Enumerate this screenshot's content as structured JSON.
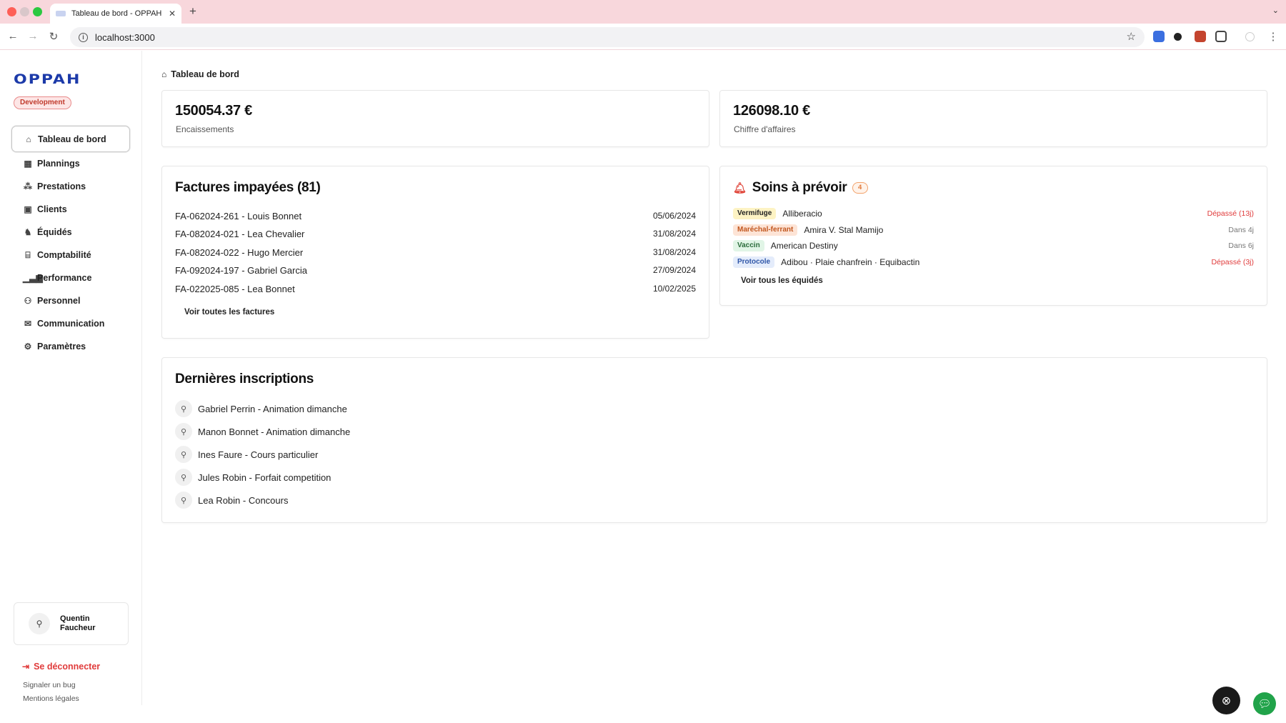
{
  "browser": {
    "tab_title": "Tableau de bord - OPPAH",
    "url": "localhost:3000"
  },
  "app": {
    "logo_text": "OPPAH",
    "environment": "Development"
  },
  "sidebar": {
    "items": [
      {
        "label": "Tableau de bord",
        "icon": "home-icon",
        "active": true
      },
      {
        "label": "Plannings",
        "icon": "calendar-icon"
      },
      {
        "label": "Prestations",
        "icon": "boxes-icon"
      },
      {
        "label": "Clients",
        "icon": "contact-icon"
      },
      {
        "label": "Équidés",
        "icon": "horse-icon"
      },
      {
        "label": "Comptabilité",
        "icon": "bank-icon"
      },
      {
        "label": "Performance",
        "icon": "bar-chart-icon"
      },
      {
        "label": "Personnel",
        "icon": "users-icon"
      },
      {
        "label": "Communication",
        "icon": "mail-icon"
      },
      {
        "label": "Paramètres",
        "icon": "gear-icon"
      }
    ],
    "user_name": "Quentin Faucheur",
    "logout_label": "Se déconnecter",
    "report_bug_label": "Signaler un bug",
    "legal_label": "Mentions légales"
  },
  "breadcrumb": {
    "label": "Tableau de bord"
  },
  "stats": {
    "collections": {
      "value": "150054.37 €",
      "label": "Encaissements"
    },
    "revenue": {
      "value": "126098.10 €",
      "label": "Chiffre d'affaires"
    }
  },
  "unpaid_invoices": {
    "title": "Factures impayées (81)",
    "rows": [
      {
        "label": "FA-062024-261 - Louis Bonnet",
        "date": "05/06/2024"
      },
      {
        "label": "FA-082024-021 - Lea Chevalier",
        "date": "31/08/2024"
      },
      {
        "label": "FA-082024-022 - Hugo Mercier",
        "date": "31/08/2024"
      },
      {
        "label": "FA-092024-197 - Gabriel Garcia",
        "date": "27/09/2024"
      },
      {
        "label": "FA-022025-085 - Lea Bonnet",
        "date": "10/02/2025"
      }
    ],
    "view_all_label": "Voir toutes les factures"
  },
  "care": {
    "title": "Soins à prévoir",
    "count": "4",
    "rows": [
      {
        "tag": "Vermifuge",
        "tag_bg": "#fdf3c4",
        "tag_color": "#222222",
        "name": "Alliberacio",
        "due": "Dépassé (13j)",
        "late": true
      },
      {
        "tag": "Maréchal-ferrant",
        "tag_bg": "#fde4d6",
        "tag_color": "#c2571f",
        "name": "Amira V. Stal Mamijo",
        "due": "Dans 4j",
        "late": false
      },
      {
        "tag": "Vaccin",
        "tag_bg": "#e1f5e6",
        "tag_color": "#2a6b3a",
        "name": "American Destiny",
        "due": "Dans 6j",
        "late": false
      },
      {
        "tag": "Protocole",
        "tag_bg": "#e4ecfb",
        "tag_color": "#2f56a8",
        "name": "Adibou · Plaie chanfrein · Equibactin",
        "due": "Dépassé (3j)",
        "late": true
      }
    ],
    "view_all_label": "Voir tous les équidés"
  },
  "registrations": {
    "title": "Dernières inscriptions",
    "rows": [
      {
        "label": "Gabriel Perrin - Animation dimanche"
      },
      {
        "label": "Manon Bonnet - Animation dimanche"
      },
      {
        "label": "Ines Faure - Cours particulier"
      },
      {
        "label": "Jules Robin - Forfait competition"
      },
      {
        "label": "Lea Robin - Concours"
      }
    ]
  },
  "colors": {
    "accent": "#1c3aa9",
    "danger": "#e03b3b",
    "chat": "#21a34a"
  }
}
